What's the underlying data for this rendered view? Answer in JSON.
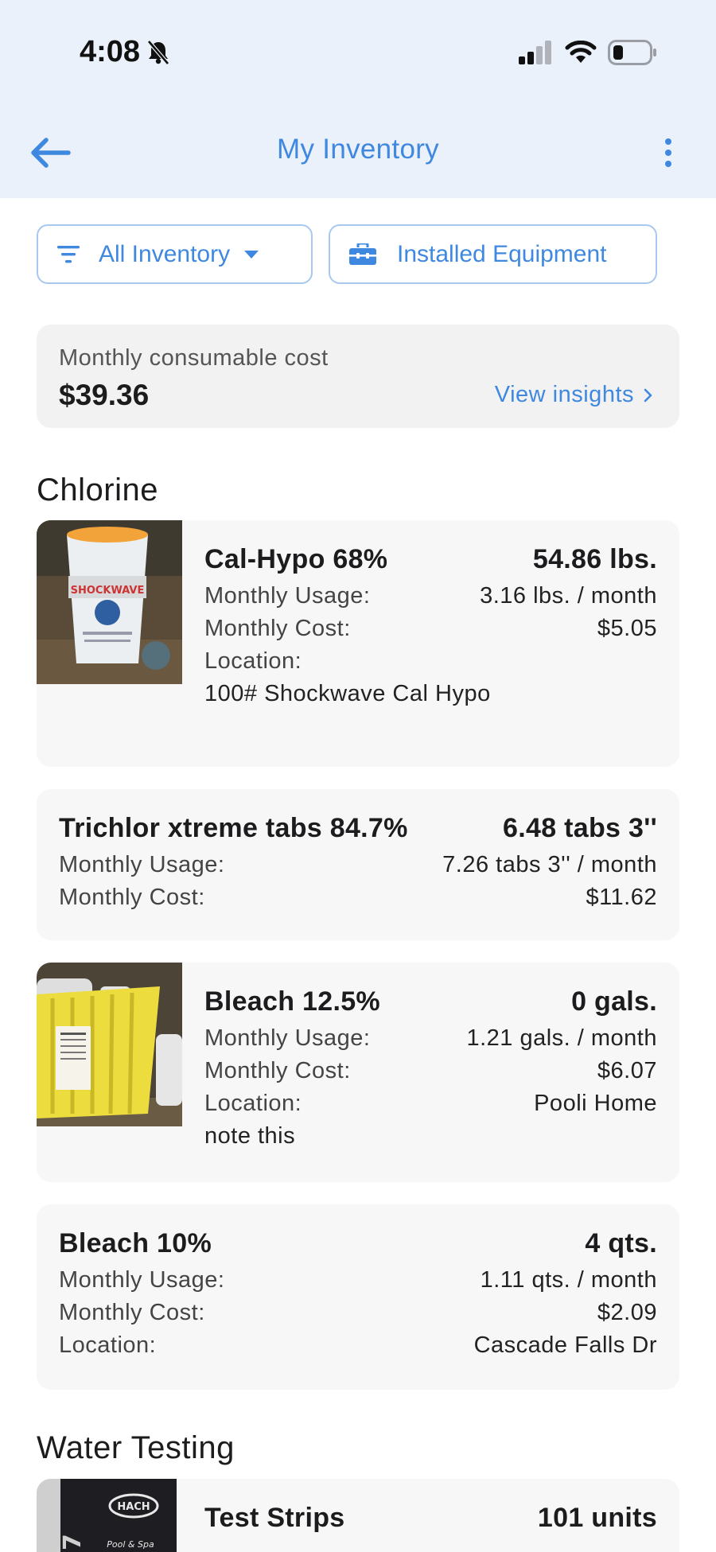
{
  "status_bar": {
    "time": "4:08"
  },
  "appbar": {
    "title": "My Inventory"
  },
  "filters": {
    "inventory_label": "All Inventory",
    "equipment_label": "Installed Equipment"
  },
  "cost_summary": {
    "label": "Monthly consumable cost",
    "value": "$39.36",
    "link_label": "View insights"
  },
  "sections": [
    {
      "title": "Chlorine"
    },
    {
      "title": "Water Testing"
    }
  ],
  "labels": {
    "usage": "Monthly Usage:",
    "cost": "Monthly Cost:",
    "location": "Location:"
  },
  "items": [
    {
      "name": "Cal-Hypo 68%",
      "qty": "54.86 lbs.",
      "usage": "3.16 lbs. / month",
      "cost": "$5.05",
      "location": "",
      "note": "100# Shockwave Cal Hypo"
    },
    {
      "name": "Trichlor xtreme tabs 84.7%",
      "qty": "6.48 tabs 3''",
      "usage": "7.26 tabs 3'' / month",
      "cost": "$11.62"
    },
    {
      "name": "Bleach 12.5%",
      "qty": "0 gals.",
      "usage": "1.21 gals. / month",
      "cost": "$6.07",
      "location": "Pooli Home",
      "note": "note this"
    },
    {
      "name": "Bleach 10%",
      "qty": "4 qts.",
      "usage": "1.11 qts. / month",
      "cost": "$2.09",
      "location": "Cascade Falls Dr"
    },
    {
      "name": "Test Strips",
      "qty": "101 units",
      "thumb_text": "HACH",
      "thumb_sub": "Pool & Spa"
    }
  ],
  "icons": {
    "back": "arrow-left-icon",
    "more": "more-vertical-icon",
    "filter": "filter-icon",
    "dropdown": "caret-down-icon",
    "toolbox": "toolbox-icon",
    "chevron": "chevron-right-icon"
  },
  "colors": {
    "accent": "#3f88df",
    "header_bg": "#eaf1fb",
    "card_bg": "#f7f7f7"
  }
}
